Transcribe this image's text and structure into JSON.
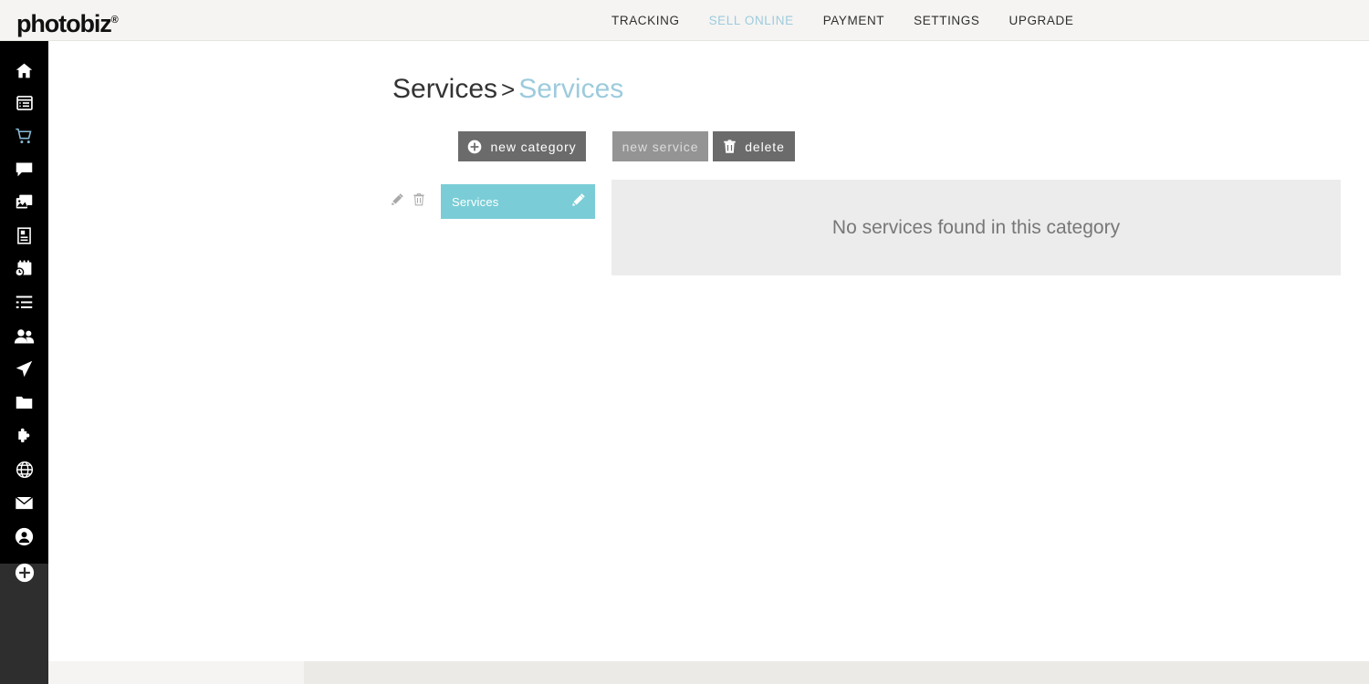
{
  "brand": {
    "name": "photobiz",
    "registered_mark": "®"
  },
  "topnav": {
    "items": [
      {
        "label": "TRACKING",
        "active": false
      },
      {
        "label": "SELL ONLINE",
        "active": true
      },
      {
        "label": "PAYMENT",
        "active": false
      },
      {
        "label": "SETTINGS",
        "active": false
      },
      {
        "label": "UPGRADE",
        "active": false
      }
    ]
  },
  "sidebar": {
    "items": [
      {
        "icon": "home-icon",
        "active": false
      },
      {
        "icon": "website-icon",
        "active": false
      },
      {
        "icon": "shopping-cart-icon",
        "active": true
      },
      {
        "icon": "chat-bubble-icon",
        "active": false
      },
      {
        "icon": "gallery-icon",
        "active": false
      },
      {
        "icon": "invoice-icon",
        "active": false
      },
      {
        "icon": "calendar-clock-icon",
        "active": false
      },
      {
        "icon": "list-icon",
        "active": false
      },
      {
        "icon": "people-icon",
        "active": false
      },
      {
        "icon": "paper-plane-icon",
        "active": false
      },
      {
        "icon": "folder-icon",
        "active": false
      },
      {
        "icon": "puzzle-piece-icon",
        "active": false
      },
      {
        "icon": "globe-icon",
        "active": false
      },
      {
        "icon": "envelope-icon",
        "active": false
      },
      {
        "icon": "user-circle-icon",
        "active": false
      }
    ],
    "add_button": {
      "icon": "plus-circle-icon"
    }
  },
  "main": {
    "breadcrumb": {
      "parent": "Services",
      "separator": ">",
      "current": "Services"
    },
    "toolbar": {
      "new_category_label": "new category",
      "new_service_label": "new service",
      "delete_label": "delete"
    },
    "categories": [
      {
        "name": "Services",
        "selected": true,
        "edit_icon": "pencil-icon",
        "delete_icon": "trash-icon",
        "inline_edit_icon": "pencil-icon"
      }
    ],
    "empty_state": {
      "message": "No services found in this category"
    }
  },
  "colors": {
    "accent_teal": "#7acdd6",
    "accent_blue": "#9dcbdd",
    "button_gray": "#6b6b6b",
    "button_disabled_gray": "#949494",
    "panel_gray": "#ececec",
    "header_bg": "#f5f4f2",
    "sidebar_black": "#000000",
    "sidebar_gray": "#2e2e2e"
  }
}
